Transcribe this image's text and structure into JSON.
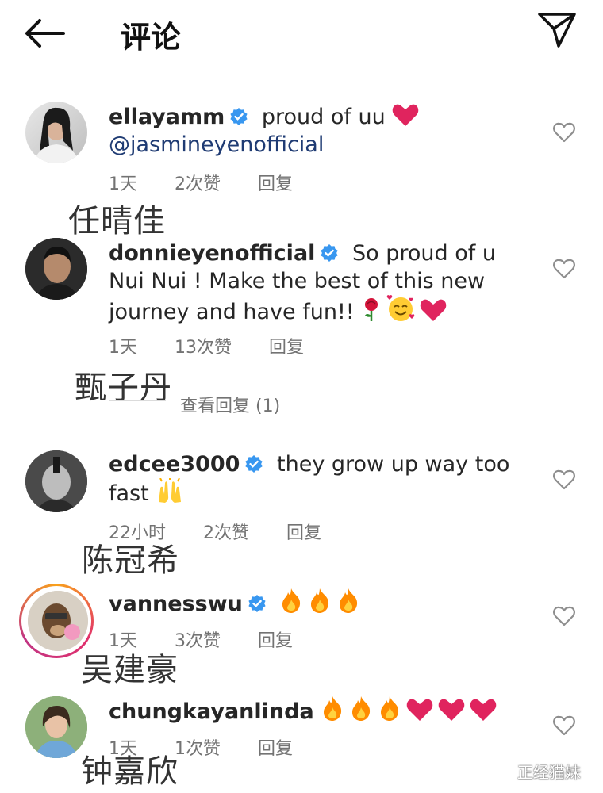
{
  "header": {
    "title": "评论"
  },
  "comments": [
    {
      "user": "ellayamm",
      "text": " proud of uu",
      "mention": "@jasmineyenofficial",
      "time": "1天",
      "likes": "2次赞",
      "reply": "回复",
      "overlay": "任晴佳"
    },
    {
      "user": "donnieyenofficial",
      "text": " So proud of u Nui Nui ! Make the best of this new journey and have fun!!",
      "time": "1天",
      "likes": "13次赞",
      "reply": "回复",
      "overlay": "甄子丹",
      "view_replies": "查看回复 (1)"
    },
    {
      "user": "edcee3000",
      "text": " they grow up way too fast",
      "time": "22小时",
      "likes": "2次赞",
      "reply": "回复",
      "overlay": "陈冠希"
    },
    {
      "user": "vannesswu",
      "time": "1天",
      "likes": "3次赞",
      "reply": "回复",
      "overlay": "吴建豪"
    },
    {
      "user": "chungkayanlinda",
      "time": "1天",
      "likes": "1次赞",
      "reply": "回复",
      "overlay": "钟嘉欣"
    }
  ],
  "watermark": "正经猫妹",
  "colors": {
    "verified": "#3897f0",
    "heart": "#e0245e",
    "fire": "#ff8c00"
  }
}
